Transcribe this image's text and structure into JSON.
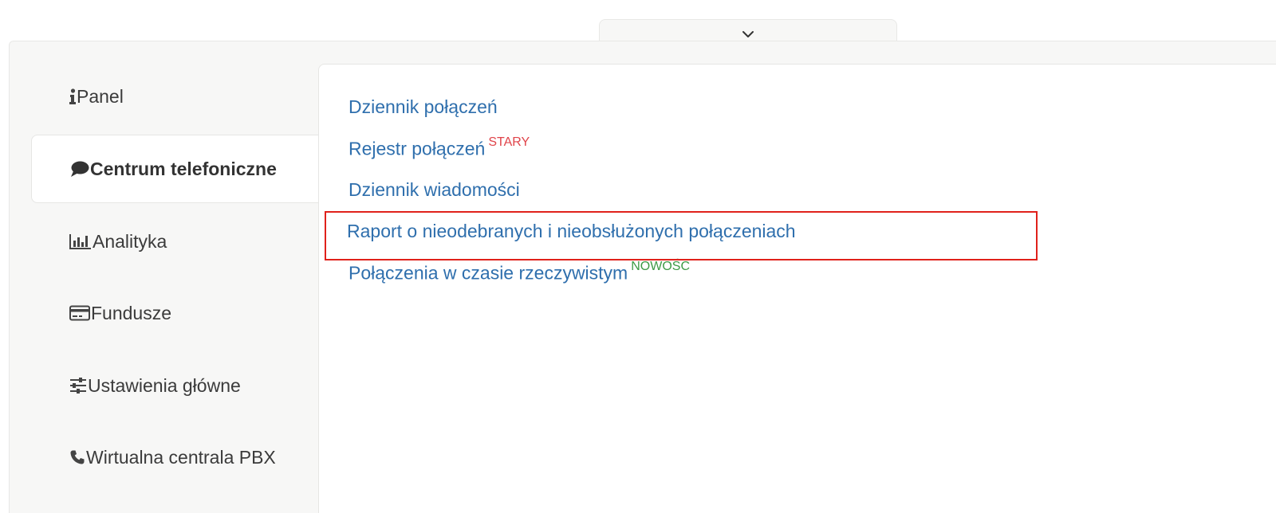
{
  "collapse_toggle": {
    "icon": "chevron-down-icon"
  },
  "sidebar": {
    "items": [
      {
        "label": "Panel",
        "icon": "info-icon",
        "active": false
      },
      {
        "label": "Centrum telefoniczne",
        "icon": "chat-bubble-icon",
        "active": true
      },
      {
        "label": "Analityka",
        "icon": "bar-chart-icon",
        "active": false
      },
      {
        "label": "Fundusze",
        "icon": "credit-card-icon",
        "active": false
      },
      {
        "label": "Ustawienia główne",
        "icon": "sliders-icon",
        "active": false
      },
      {
        "label": "Wirtualna centrala PBX",
        "icon": "phone-icon",
        "active": false
      }
    ]
  },
  "content": {
    "links": [
      {
        "label": "Dziennik połączeń",
        "badge": ""
      },
      {
        "label": "Rejestr połączeń",
        "badge": "STARY"
      },
      {
        "label": "Dziennik wiadomości",
        "badge": ""
      },
      {
        "label": "Raport o nieodebranych i nieobsłużonych połączeniach",
        "badge": "",
        "highlighted": true
      },
      {
        "label": "Połączenia w czasie rzeczywistym",
        "badge": "NOWOŚĆ"
      }
    ]
  },
  "colors": {
    "link": "#2f6fad",
    "badge_old": "#e0444a",
    "badge_new": "#3d9a45",
    "highlight": "#e0211b",
    "panel_bg": "#f7f7f6"
  }
}
